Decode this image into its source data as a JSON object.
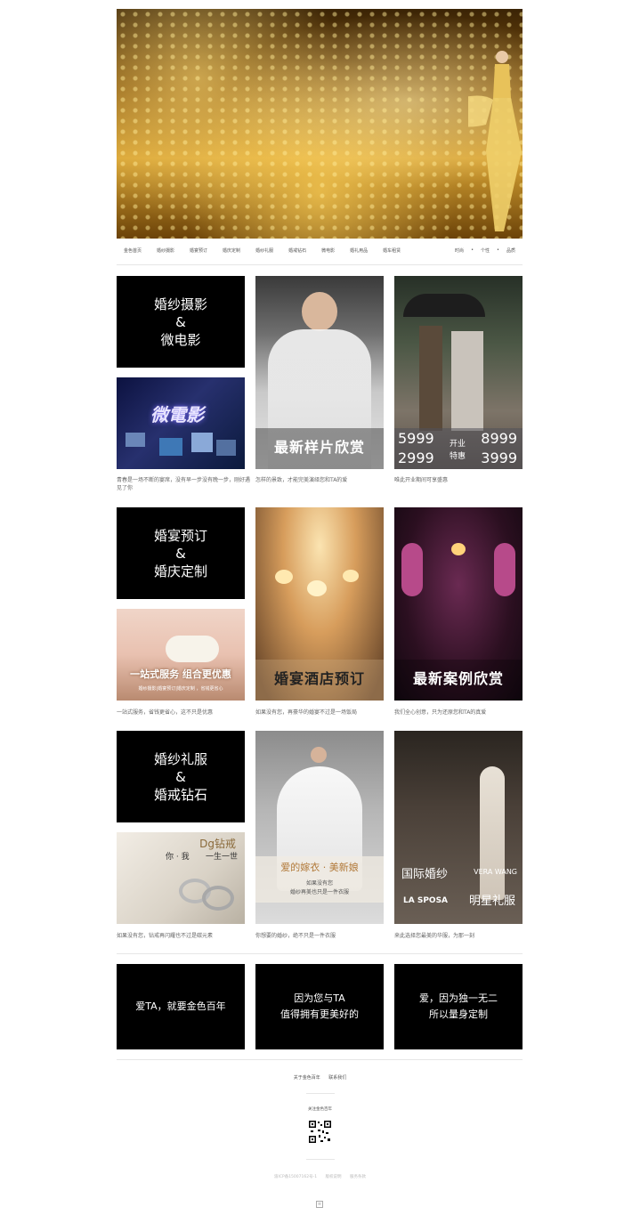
{
  "nav": {
    "items": [
      "金色首页",
      "婚纱摄影",
      "婚宴预订",
      "婚庆定制",
      "婚纱礼服",
      "婚戒钻石",
      "微电影",
      "婚礼用品",
      "婚车租赁"
    ],
    "right": [
      "时尚",
      "个性",
      "品质"
    ]
  },
  "rows": [
    {
      "black_lines": [
        "婚纱摄影",
        "&",
        "微电影"
      ],
      "small_img_text": "微電影",
      "photo2_title": "最新样片欣赏",
      "photo3_prices": {
        "a": "5999",
        "b": "8999",
        "c": "2999",
        "d": "3999",
        "mid1": "开业",
        "mid2": "特惠"
      },
      "captions": [
        "青春是一场不断的宴席，没有早一步没有晚一步，刚好遇见了你",
        "怎样的景致，才能完美演绎您和TA的爱",
        "唯此开业期间可享盛惠"
      ]
    },
    {
      "black_lines": [
        "婚宴预订",
        "&",
        "婚庆定制"
      ],
      "small_img_text": "一站式服务 组合更优惠",
      "small_img_sub": "婚纱摄影|婚宴预订|婚庆定制 ，省钱更省心",
      "photo2_title": "婚宴酒店预订",
      "photo3_title": "最新案例欣赏",
      "captions": [
        "一站式服务，省钱更省心，这不只是优惠",
        "如果没有您，再豪华的婚宴不过是一场饭局",
        "我们全心创意，只为还原您和TA的真爱"
      ]
    },
    {
      "black_lines": [
        "婚纱礼服",
        "&",
        "婚戒钻石"
      ],
      "small_img_brand": "Dg钻戒",
      "small_img_text1": "你 · 我",
      "small_img_text2": "一生一世",
      "photo2_title": "爱的嫁衣 · 美新娘",
      "photo2_sub1": "如果没有您",
      "photo2_sub2": "婚纱再美也只是一件衣服",
      "photo3_t1": "国际婚纱",
      "photo3_t2": "VERA WANG",
      "photo3_t3": "LA SPOSA",
      "photo3_t4": "明星礼服",
      "captions": [
        "如果没有您，钻戒再闪耀也不过是碳元素",
        "你想要的婚纱，绝不只是一件衣服",
        "来此选择您最美的华服，为那一刻"
      ]
    }
  ],
  "banners": [
    {
      "l1": "爱TA，就要金色百年",
      "l2": ""
    },
    {
      "l1": "因为您与TA",
      "l2": "值得拥有更美好的"
    },
    {
      "l1": "爱，因为独一无二",
      "l2": "所以量身定制"
    }
  ],
  "footer": {
    "links": [
      "关于金色百年",
      "联系我们"
    ],
    "follow": "关注金色百年",
    "icp": [
      "渝ICP备15007162号-1",
      "版权说明",
      "服务条款"
    ]
  }
}
